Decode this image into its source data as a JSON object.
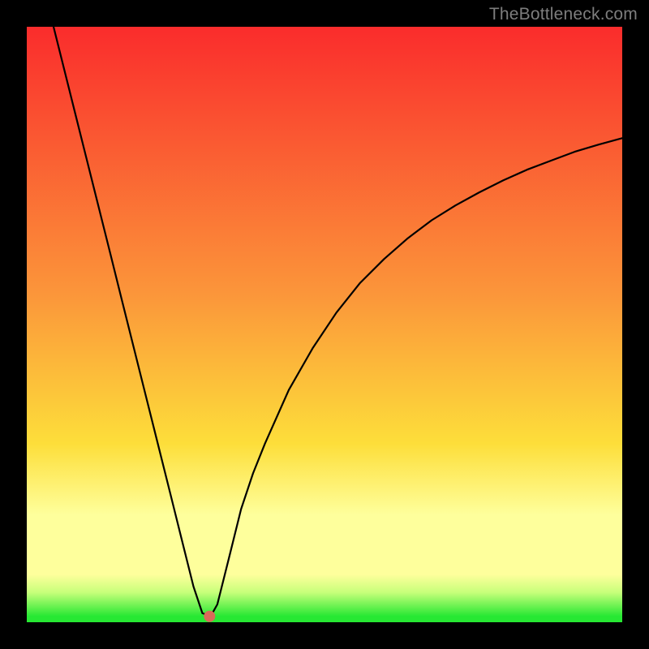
{
  "watermark": {
    "text": "TheBottleneck.com"
  },
  "colors": {
    "top": "#fa2c2c",
    "orange": "#fb963a",
    "yellow": "#fdde3a",
    "lightyellow": "#feff9c",
    "paleyellowgreen": "#c7ff7a",
    "green": "#27e833",
    "marker": "#d96a59"
  },
  "chart_data": {
    "type": "line",
    "title": "",
    "xlabel": "",
    "ylabel": "",
    "xlim": [
      0,
      100
    ],
    "ylim": [
      0,
      100
    ],
    "grid": false,
    "legend": false,
    "series": [
      {
        "name": "bottleneck-curve",
        "x": [
          4.5,
          6,
          8,
          10,
          12,
          14,
          16,
          18,
          20,
          22,
          24,
          26,
          28,
          29.5,
          30.5,
          31,
          32,
          34,
          36,
          38,
          40,
          44,
          48,
          52,
          56,
          60,
          64,
          68,
          72,
          76,
          80,
          84,
          88,
          92,
          96,
          100
        ],
        "y": [
          100,
          94,
          86,
          78,
          70,
          62,
          54,
          46,
          38,
          30,
          22,
          14,
          6,
          1.5,
          1.2,
          1.2,
          3,
          11,
          19,
          25,
          30,
          39,
          46,
          52,
          57,
          61,
          64.5,
          67.5,
          70,
          72.2,
          74.2,
          76,
          77.5,
          79,
          80.2,
          81.3
        ]
      }
    ],
    "markers": [
      {
        "name": "min-point",
        "x": 30.7,
        "y": 1.0
      }
    ],
    "background_gradient": {
      "direction": "vertical",
      "stops": [
        {
          "pos": 0,
          "color": "#fa2c2c"
        },
        {
          "pos": 45,
          "color": "#fb963a"
        },
        {
          "pos": 70,
          "color": "#fdde3a"
        },
        {
          "pos": 82,
          "color": "#feff9c"
        },
        {
          "pos": 95,
          "color": "#c7ff7a"
        },
        {
          "pos": 100,
          "color": "#27e833"
        }
      ]
    }
  }
}
